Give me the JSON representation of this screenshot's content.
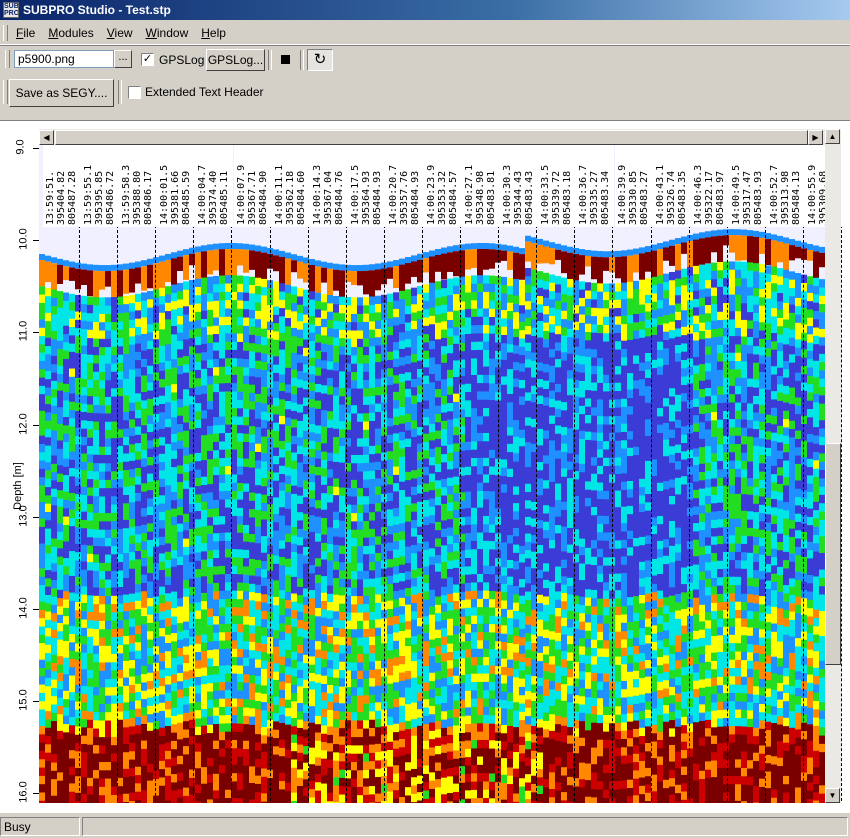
{
  "window": {
    "title": "SUBPRO Studio - Test.stp",
    "icon": "SUB PRO"
  },
  "menu": [
    {
      "label": "File",
      "mnemonic": "F",
      "rest": "ile"
    },
    {
      "label": "Modules",
      "mnemonic": "M",
      "rest": "odules"
    },
    {
      "label": "View",
      "mnemonic": "V",
      "rest": "iew"
    },
    {
      "label": "Window",
      "mnemonic": "W",
      "rest": "indow"
    },
    {
      "label": "Help",
      "mnemonic": "H",
      "rest": "elp"
    }
  ],
  "toolbar": {
    "file_value": "p5900.png",
    "browse_label": "...",
    "gpslog_checkbox_label": "GPSLog",
    "gpslog_checked": "✓",
    "gpslog_button_label": "GPSLog...",
    "save_segy_label": "Save as SEGY....",
    "extended_header_label": "Extended Text Header",
    "loop_icon": "↻"
  },
  "chart_data": {
    "type": "heatmap",
    "ylabel": "Depth [m]",
    "ylim": [
      9.0,
      16.0
    ],
    "yticks": [
      "9.0",
      "10.0",
      "11.0",
      "12.0",
      "13.0",
      "14.0",
      "15.0",
      "16.0"
    ],
    "colormap": [
      "#f0f0ff",
      "#3b3bd6",
      "#1e90ff",
      "#00e5e5",
      "#22dd22",
      "#ffff00",
      "#ff8800",
      "#cc0000",
      "#7a0000"
    ],
    "gps_markers": [
      {
        "time": "13:59:51.",
        "easting": "395404.82",
        "northing": "805487.28"
      },
      {
        "time": "13:59:55.1",
        "easting": "395395.85",
        "northing": "805486.72"
      },
      {
        "time": "13:59:58.3",
        "easting": "395388.80",
        "northing": "805486.17"
      },
      {
        "time": "14:00:01.5",
        "easting": "395381.66",
        "northing": "805485.59"
      },
      {
        "time": "14:00:04.7",
        "easting": "395374.40",
        "northing": "805485.11"
      },
      {
        "time": "14:00:07.9",
        "easting": "395367.71",
        "northing": "805484.90"
      },
      {
        "time": "14:00:11.1",
        "easting": "395362.18",
        "northing": "805484.60"
      },
      {
        "time": "14:00:14.3",
        "easting": "395367.04",
        "northing": "805484.76"
      },
      {
        "time": "14:00:17.5",
        "easting": "395364.93",
        "northing": "805484.93"
      },
      {
        "time": "14:00:20.7",
        "easting": "395357.76",
        "northing": "805484.93"
      },
      {
        "time": "14:00:23.9",
        "easting": "395353.32",
        "northing": "805484.57"
      },
      {
        "time": "14:00:27.1",
        "easting": "395348.98",
        "northing": "805483.81"
      },
      {
        "time": "14:00:30.3",
        "easting": "395344.43",
        "northing": "805483.43"
      },
      {
        "time": "14:00:33.5",
        "easting": "395339.72",
        "northing": "805483.18"
      },
      {
        "time": "14:00:36.7",
        "easting": "395335.27",
        "northing": "805483.34"
      },
      {
        "time": "14:00:39.9",
        "easting": "395330.85",
        "northing": "805483.27"
      },
      {
        "time": "14:00:43.1",
        "easting": "395326.74",
        "northing": "805483.35"
      },
      {
        "time": "14:00:46.3",
        "easting": "395322.17",
        "northing": "805483.97"
      },
      {
        "time": "14:00:49.5",
        "easting": "395317.47",
        "northing": "805483.93"
      },
      {
        "time": "14:00:52.7",
        "easting": "395313.98",
        "northing": "805484.13"
      },
      {
        "time": "14:00:55.9",
        "easting": "395309.68",
        "northing": "805484.57"
      }
    ]
  },
  "status": {
    "text": "Busy"
  }
}
